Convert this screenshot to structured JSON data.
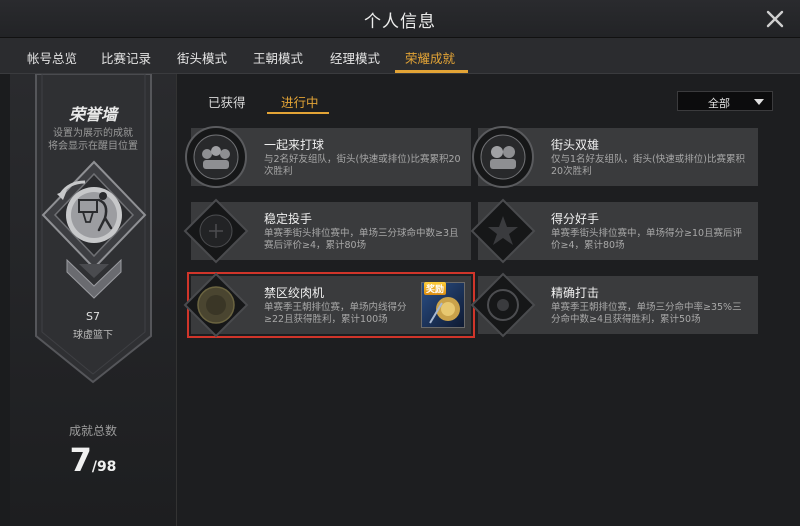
{
  "window": {
    "title": "个人信息"
  },
  "tabs": [
    {
      "label": "帐号总览"
    },
    {
      "label": "比赛记录"
    },
    {
      "label": "街头模式"
    },
    {
      "label": "王朝模式"
    },
    {
      "label": "经理模式"
    },
    {
      "label": "荣耀成就",
      "active": true
    }
  ],
  "honor_wall": {
    "title": "荣誉墙",
    "desc_line1": "设置为展示的成就",
    "desc_line2": "将会显示在醒目位置",
    "season": "S7",
    "season_name": "球虚篮下",
    "total_label": "成就总数",
    "total_done": "7",
    "total_all": "/98"
  },
  "subtabs": [
    {
      "label": "已获得"
    },
    {
      "label": "进行中",
      "active": true
    }
  ],
  "filter": {
    "value": "全部"
  },
  "achievements": [
    {
      "name": "一起来打球",
      "desc": "与2名好友组队，街头(快速或排位)比赛累积20次胜利"
    },
    {
      "name": "街头双雄",
      "desc": "仅与1名好友组队，街头(快速或排位)比赛累积20次胜利"
    },
    {
      "name": "稳定投手",
      "desc": "单赛季街头排位赛中，单场三分球命中数≥3且赛后评价≥4，累计80场"
    },
    {
      "name": "得分好手",
      "desc": "单赛季街头排位赛中，单场得分≥10且赛后评价≥4，累计80场"
    },
    {
      "name": "禁区绞肉机",
      "desc": "单赛季王朝排位赛，单场内线得分≥22且获得胜利，累计100场",
      "reward_label": "奖励",
      "highlighted": true
    },
    {
      "name": "精确打击",
      "desc": "单赛季王朝排位赛，单场三分命中率≥35%三分命中数≥4且获得胜利，累计50场"
    }
  ],
  "colors": {
    "accent": "#e3a436",
    "highlight": "#d0352a",
    "card_bg": "#3a3b3d"
  },
  "icons": {
    "close": "close-icon",
    "filter": "chevron-down-icon",
    "emblem": "basketball-hoop-emblem-icon"
  }
}
